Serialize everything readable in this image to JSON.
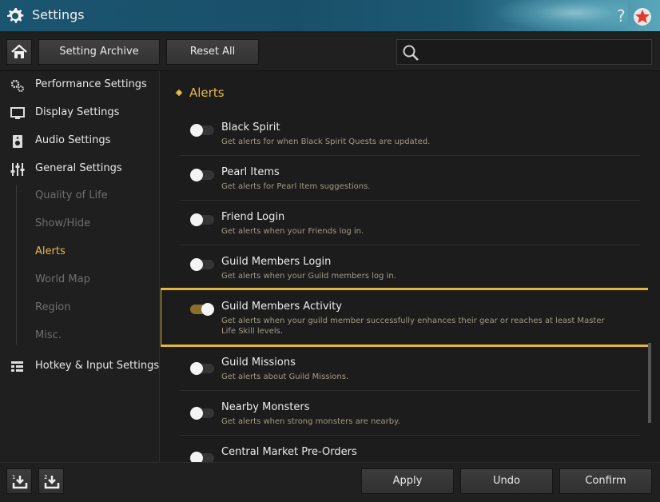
{
  "window": {
    "title": "Settings",
    "help": "?"
  },
  "toolbar": {
    "archive_label": "Setting Archive",
    "reset_label": "Reset All"
  },
  "sidebar": {
    "categories": [
      {
        "label": "Performance Settings",
        "icon": "gears-icon"
      },
      {
        "label": "Display Settings",
        "icon": "monitor-icon"
      },
      {
        "label": "Audio Settings",
        "icon": "speaker-icon"
      },
      {
        "label": "General Settings",
        "icon": "sliders-icon"
      },
      {
        "label": "Hotkey & Input Settings",
        "icon": "keyboard-icon"
      }
    ],
    "subitems": [
      "Quality of Life",
      "Show/Hide",
      "Alerts",
      "World Map",
      "Region",
      "Misc."
    ],
    "active_subitem": "Alerts"
  },
  "content": {
    "section_title": "Alerts",
    "alerts": [
      {
        "title": "Black Spirit",
        "desc": "Get alerts for when Black Spirit Quests are updated.",
        "enabled": false
      },
      {
        "title": "Pearl Items",
        "desc": "Get alerts for Pearl Item suggestions.",
        "enabled": false
      },
      {
        "title": "Friend Login",
        "desc": "Get alerts when your Friends log in.",
        "enabled": false
      },
      {
        "title": "Guild Members Login",
        "desc": "Get alerts when your Guild members log in.",
        "enabled": false
      },
      {
        "title": "Guild Members Activity",
        "desc": "Get alerts when your guild member successfully enhances their gear or reaches at least Master Life Skill levels.",
        "enabled": true
      },
      {
        "title": "Guild Missions",
        "desc": "Get alerts about Guild Missions.",
        "enabled": false
      },
      {
        "title": "Nearby Monsters",
        "desc": "Get alerts when strong monsters are nearby.",
        "enabled": false
      },
      {
        "title": "Central Market Pre-Orders",
        "desc": "",
        "enabled": false
      }
    ]
  },
  "footer": {
    "apply_label": "Apply",
    "undo_label": "Undo",
    "confirm_label": "Confirm",
    "slot1": "1",
    "slot2": "2"
  },
  "colors": {
    "accent": "#e8b84a",
    "titlebar": "#1b5570",
    "highlight_border": "#e4b640"
  }
}
